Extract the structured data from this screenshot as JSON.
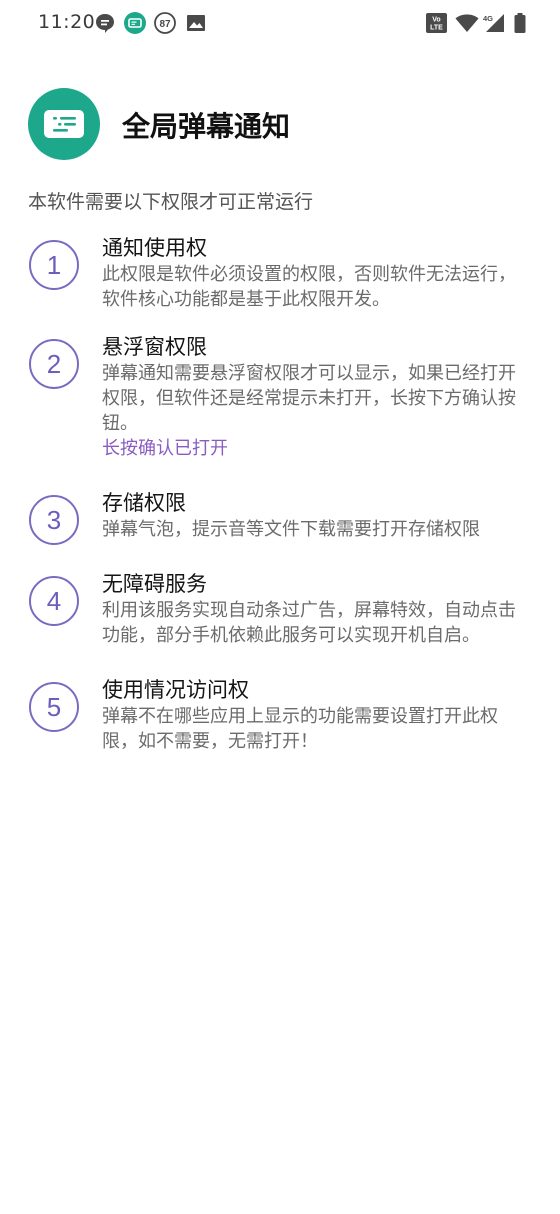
{
  "status_bar": {
    "time": "11:20",
    "notification_badge": "87",
    "network_label": "4G",
    "volte_label": "Vo LTE"
  },
  "header": {
    "title": "全局弹幕通知",
    "app_icon": "danmaku-bubble-icon",
    "brand_color": "#1ea88b"
  },
  "intro": "本软件需要以下权限才可正常运行",
  "accent_color": "#7a6bc2",
  "permissions": [
    {
      "number": "1",
      "title": "通知使用权",
      "desc": "此权限是软件必须设置的权限，否则软件无法运行，软件核心功能都是基于此权限开发。"
    },
    {
      "number": "2",
      "title": "悬浮窗权限",
      "desc": "弹幕通知需要悬浮窗权限才可以显示，如果已经打开权限，但软件还是经常提示未打开，长按下方确认按钮。",
      "link": "长按确认已打开"
    },
    {
      "number": "3",
      "title": "存储权限",
      "desc": "弹幕气泡，提示音等文件下载需要打开存储权限"
    },
    {
      "number": "4",
      "title": "无障碍服务",
      "desc": "利用该服务实现自动条过广告，屏幕特效，自动点击功能，部分手机依赖此服务可以实现开机自启。"
    },
    {
      "number": "5",
      "title": "使用情况访问权",
      "desc": "弹幕不在哪些应用上显示的功能需要设置打开此权限，如不需要，无需打开！"
    }
  ]
}
